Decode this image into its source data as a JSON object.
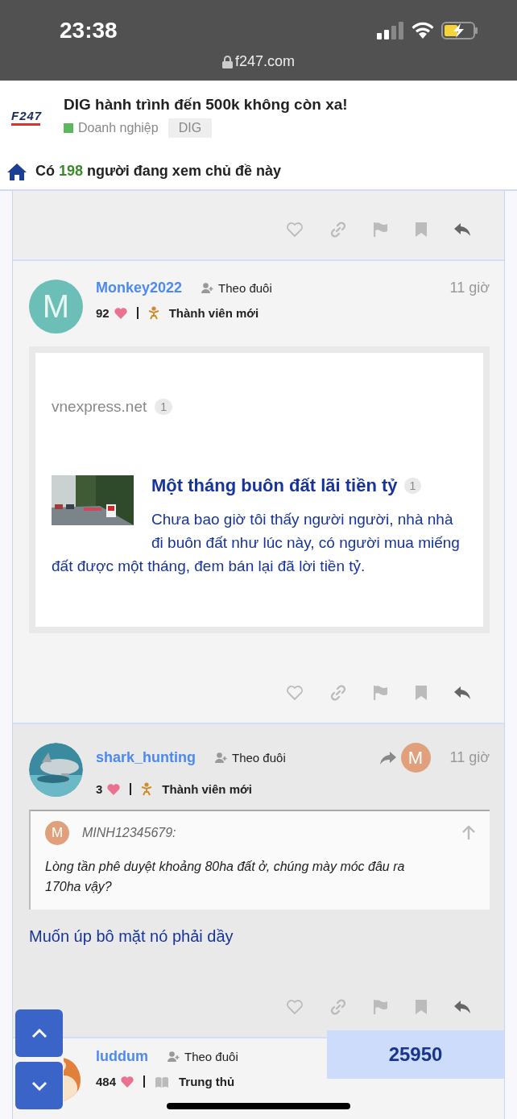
{
  "status_bar": {
    "time": "23:38",
    "url": "f247.com"
  },
  "topic": {
    "logo": "F247",
    "title": "DIG hành trình đến 500k không còn xa!",
    "category": {
      "name": "Doanh nghiệp",
      "color": "#5cb85c"
    },
    "tag": "DIG"
  },
  "viewers": {
    "prefix": "Có",
    "count": "198",
    "suffix": "người đang xem chủ đề này"
  },
  "posts": [
    {
      "kind": "tail"
    },
    {
      "kind": "post",
      "username": "Monkey2022",
      "avatar": {
        "kind": "letter",
        "letter": "M",
        "color": "#6cbfb6"
      },
      "follow": "Theo đuôi",
      "time": "11 giờ",
      "likes": "92",
      "title": {
        "kind": "baby",
        "text": "Thành viên mới"
      },
      "onebox": {
        "site": "vnexpress.net",
        "site_count": "1",
        "title": "Một tháng buôn đất lãi tiền tỷ",
        "title_count": "1",
        "excerpt": "Chưa bao giờ tôi thấy người người, nhà nhà đi buôn đất như lúc này, có người mua miếng đất được một tháng, đem bán lại đã lời tiền tỷ."
      }
    },
    {
      "kind": "post",
      "username": "shark_hunting",
      "follow": "Theo đuôi",
      "time": "11 giờ",
      "reply_to": {
        "letter": "M",
        "color": "#e0a07c"
      },
      "likes": "3",
      "title": {
        "kind": "baby",
        "text": "Thành viên mới"
      },
      "quote": {
        "avatar": {
          "letter": "M",
          "color": "#e0a07c"
        },
        "author": "MINH12345679:",
        "text": "Lòng tần phê duyệt khoảng 80ha đất ở, chúng mày móc đâu ra 170ha vậy?"
      },
      "body": "Muốn úp bô mặt nó phải dầy"
    },
    {
      "kind": "cut",
      "username": "luddum",
      "follow": "Theo đuôi",
      "likes": "484",
      "title": {
        "kind": "book",
        "text": "Trung thủ"
      }
    }
  ],
  "post_counter": "25950"
}
